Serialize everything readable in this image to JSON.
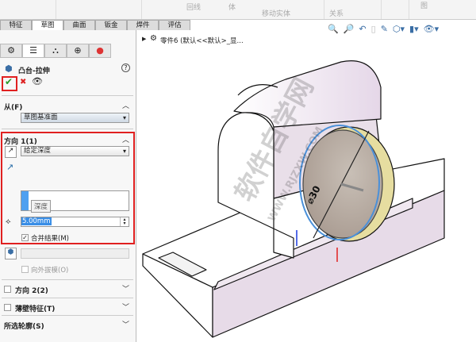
{
  "toolbar": {
    "items": [
      "回线",
      "体",
      "移动实体",
      "关系",
      "图"
    ],
    "view_icons": [
      "zoom-to-fit-icon",
      "zoom-area-icon",
      "previous-view-icon",
      "section-view-icon",
      "dynamic-annotation-icon",
      "view-orientation-icon",
      "display-style-icon",
      "hide-show-icon"
    ]
  },
  "tabs": [
    "特征",
    "草图",
    "曲面",
    "钣金",
    "焊件",
    "评估"
  ],
  "active_tab": "草图",
  "tree": {
    "label": "零件6 (默认<<默认>_显..."
  },
  "feature": {
    "title": "凸台-拉伸",
    "help": "?"
  },
  "from": {
    "label": "从(F)",
    "value": "草图基准面"
  },
  "direction1": {
    "label": "方向 1(1)",
    "end_condition": "给定深度",
    "tooltip": "深度",
    "depth": "5.00mm",
    "merge_label": "合并结果(M)",
    "merge_checked": true,
    "draft_label": "向外拔模(O)"
  },
  "direction2": {
    "label": "方向 2(2)"
  },
  "thin": {
    "label": "薄壁特征(T)"
  },
  "contours": {
    "label": "所选轮廓(S)"
  },
  "dimension": "⌀30",
  "watermark": {
    "text": "软件自学网",
    "url": "WWW.RJZXW.COM"
  },
  "colors": {
    "accent": "#e02020",
    "ok": "#2a9a2a",
    "face": "#e7dbe8",
    "circle": "#6fa8dc"
  }
}
